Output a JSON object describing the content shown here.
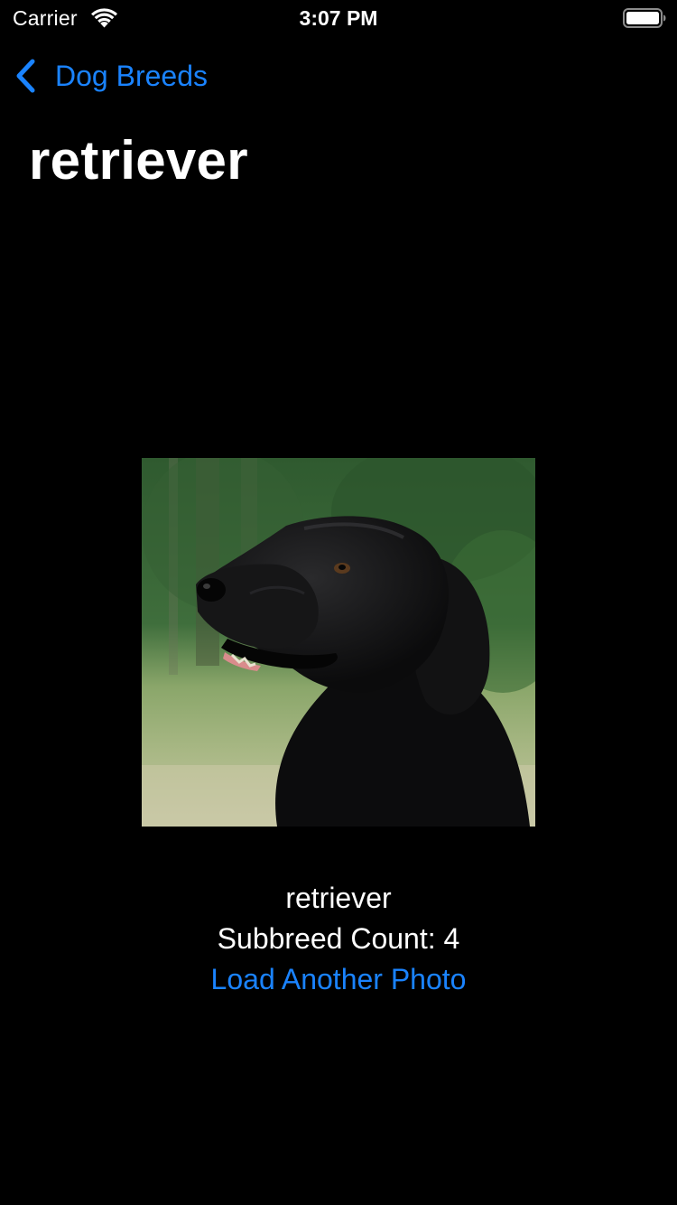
{
  "status_bar": {
    "carrier": "Carrier",
    "time": "3:07 PM",
    "icons": [
      "wifi-icon",
      "battery-icon"
    ]
  },
  "nav": {
    "back_label": "Dog Breeds",
    "back_icon": "chevron-left-icon",
    "title": "retriever"
  },
  "photo": {
    "subject": "black flat-coated retriever dog"
  },
  "info": {
    "breed": "retriever",
    "subbreed_count": "Subbreed Count: 4",
    "load_button_label": "Load Another Photo"
  },
  "colors": {
    "background": "#000000",
    "text": "#ffffff",
    "accent": "#1a83ff"
  }
}
